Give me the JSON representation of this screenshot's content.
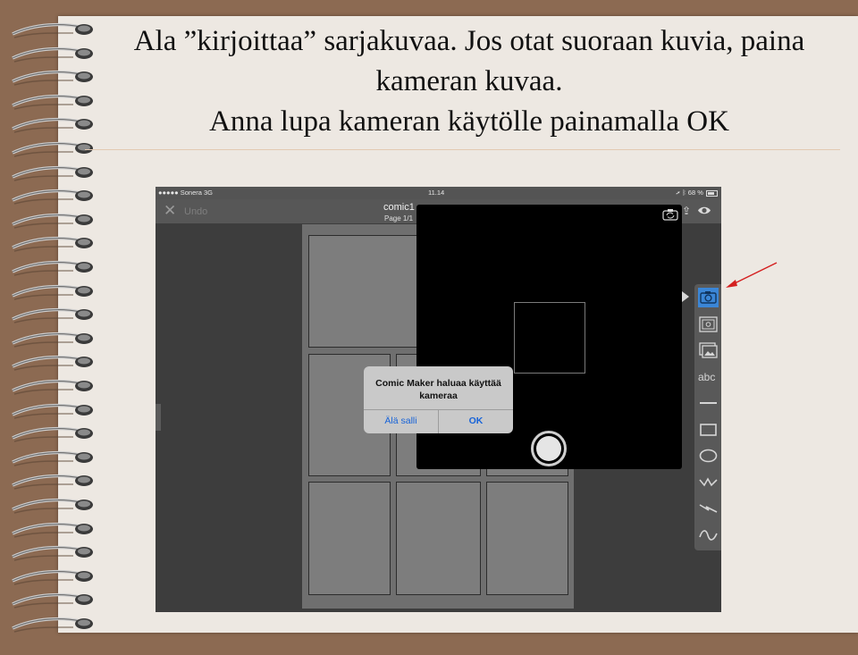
{
  "slide": {
    "title_lines": [
      "Ala ”kirjoittaa” sarjakuvaa. Jos otat suoraan kuvia, paina",
      "kameran kuvaa.",
      "Anna lupa kameran käytölle painamalla OK"
    ]
  },
  "statusbar": {
    "carrier": "●●●●● Sonera  3G",
    "time": "11.14",
    "battery": "68 %"
  },
  "navbar": {
    "close_icon": "close-icon",
    "undo_label": "Undo",
    "document_title": "comic1",
    "page_indicator": "Page 1/1"
  },
  "toolbar": {
    "tools": [
      "camera-icon",
      "photo-frame-icon",
      "gallery-icon",
      "text-abc-icon",
      "line-icon",
      "rectangle-icon",
      "ellipse-icon",
      "zigzag-icon",
      "lightning-icon",
      "wave-icon"
    ],
    "text_tool_label": "abc"
  },
  "camera_view": {
    "switch_icon": "camera-switch-icon",
    "shutter_icon": "shutter-button"
  },
  "alert": {
    "message": "Comic Maker haluaa käyttää kameraa",
    "deny_label": "Älä salli",
    "ok_label": "OK"
  },
  "colors": {
    "alert_button_blue": "#1763d8",
    "selected_tool_blue": "#3b86d6",
    "arrow_red": "#d42020",
    "backdrop_brown": "#8c6a52"
  }
}
